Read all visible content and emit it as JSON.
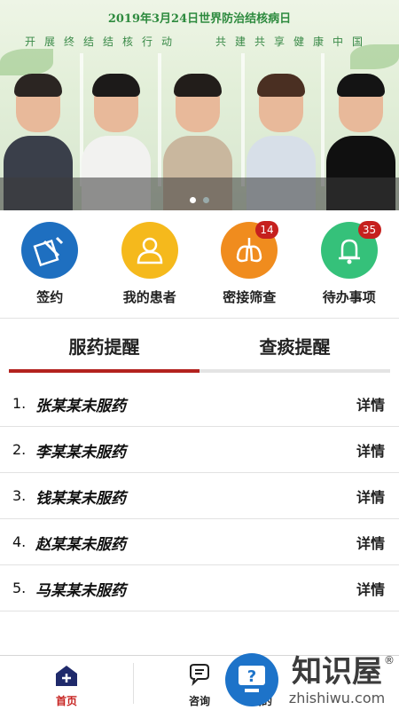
{
  "banner": {
    "title": "2019年3月24日世界防治结核病日",
    "slogan_left": "开展终结结核行动",
    "slogan_right": "共建共享健康中国",
    "slide_count": 2,
    "active_slide": 1
  },
  "actions": [
    {
      "label": "签约",
      "icon": "sign-document-icon",
      "color": "#1e6fc0",
      "badge": ""
    },
    {
      "label": "我的患者",
      "icon": "person-icon",
      "color": "#f5b91c",
      "badge": ""
    },
    {
      "label": "密接筛查",
      "icon": "lungs-icon",
      "color": "#f08c1e",
      "badge": "14"
    },
    {
      "label": "待办事项",
      "icon": "bell-icon",
      "color": "#35c17a",
      "badge": "35"
    }
  ],
  "tabs": [
    {
      "label": "服药提醒",
      "active": true
    },
    {
      "label": "查痰提醒",
      "active": false
    }
  ],
  "reminders": [
    {
      "index": "1.",
      "name": "张某某未服药",
      "detail": "详情"
    },
    {
      "index": "2.",
      "name": "李某某未服药",
      "detail": "详情"
    },
    {
      "index": "3.",
      "name": "钱某某未服药",
      "detail": "详情"
    },
    {
      "index": "4.",
      "name": "赵某某未服药",
      "detail": "详情"
    },
    {
      "index": "5.",
      "name": "马某某未服药",
      "detail": "详情"
    }
  ],
  "nav": [
    {
      "label": "首页",
      "icon": "home-icon",
      "active": true,
      "color": "#c6201e"
    },
    {
      "label": "咨询",
      "icon": "chat-icon",
      "active": false,
      "color": "#222222"
    },
    {
      "label": "我的",
      "icon": "user-icon",
      "active": false,
      "color": "#222222"
    }
  ],
  "watermark": {
    "text": "知识屋",
    "sub": "zhishiwu.com",
    "registered": "®"
  }
}
